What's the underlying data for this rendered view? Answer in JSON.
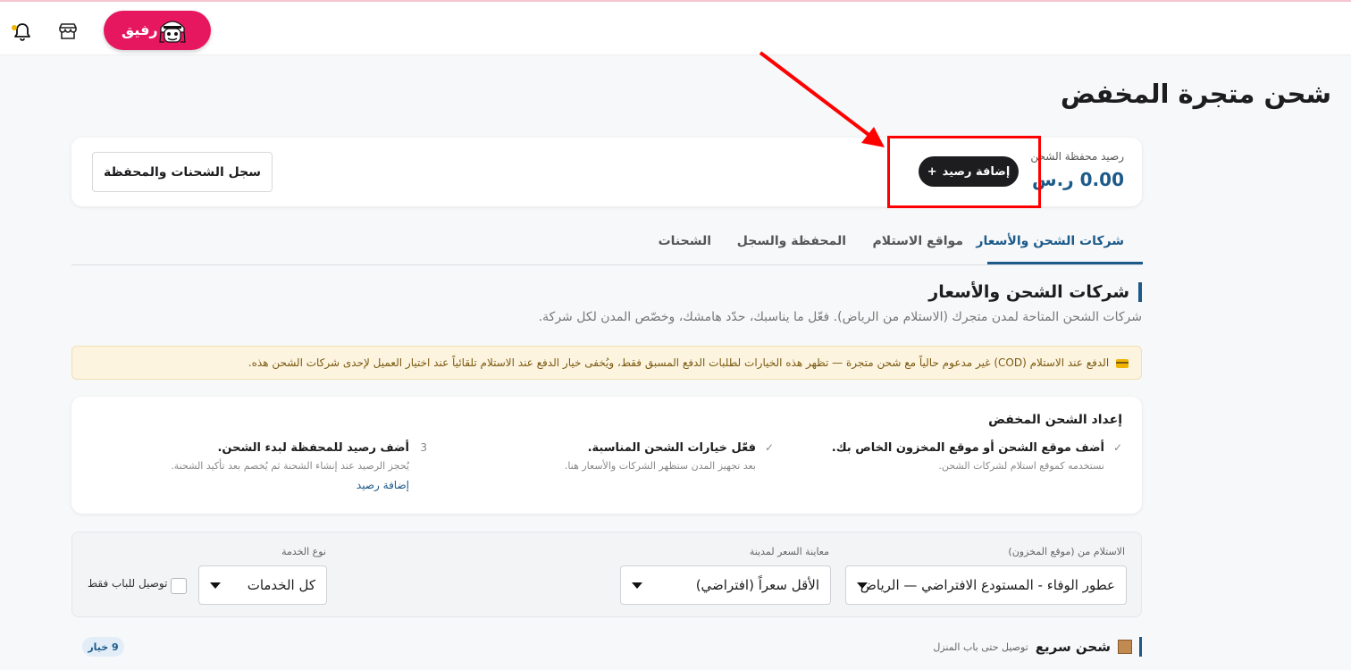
{
  "topbar": {
    "brand_label": "رفيق",
    "icons": [
      "bell-icon",
      "store-icon",
      "rafeeq-avatar-icon"
    ]
  },
  "page": {
    "title": "شحن متجرة المخفض"
  },
  "wallet": {
    "label": "رصيد محفظة الشحن",
    "amount": "0.00 ر.س",
    "add_button": "إضافة رصيد",
    "add_icon": "+",
    "history_button": "سجل الشحنات والمحفظة"
  },
  "tabs": [
    {
      "label": "شركات الشحن والأسعار",
      "active": true
    },
    {
      "label": "مواقع الاستلام",
      "active": false
    },
    {
      "label": "المحفظة والسجل",
      "active": false
    },
    {
      "label": "الشحنات",
      "active": false
    }
  ],
  "section": {
    "title": "شركات الشحن والأسعار",
    "subtitle": "شركات الشحن المتاحة لمدن متجرك (الاستلام من الرياض). فعّل ما يناسبك، حدّد هامشك، وخصّص المدن لكل شركة."
  },
  "cod_notice": "الدفع عند الاستلام (COD) غير مدعوم حالياً مع شحن متجرة — تظهر هذه الخيارات لطلبات الدفع المسبق فقط، ويُخفى خيار الدفع عند الاستلام تلقائياً عند اختيار العميل لإحدى شركات الشحن هذه.",
  "setup": {
    "title": "إعداد الشحن المخفض",
    "steps": [
      {
        "mark": "✓",
        "title": "أضف موقع الشحن أو موقع المخزون الخاص بك.",
        "desc": "نستخدمه كموقع استلام لشركات الشحن."
      },
      {
        "mark": "✓",
        "title": "فعّل خيارات الشحن المناسبة.",
        "desc": "بعد تجهيز المدن ستظهر الشركات والأسعار هنا."
      },
      {
        "mark": "3",
        "title": "أضف رصيد للمحفظة لبدء الشحن.",
        "desc": "يُحجز الرصيد عند إنشاء الشحنة ثم يُخصم بعد تأكيد الشحنة.",
        "link": "إضافة رصيد"
      }
    ]
  },
  "filters": {
    "pickup_label": "الاستلام من (موقع المخزون)",
    "pickup_value": "عطور الوفاء - المستودع الافتراضي — الرياض",
    "city_label": "معاينة السعر لمدينة",
    "city_value": "الأقل سعراً (افتراضي)",
    "service_label": "نوع الخدمة",
    "service_value": "كل الخدمات",
    "door_only_label": "توصيل للباب فقط",
    "door_only_checked": false
  },
  "group": {
    "title": "شحن سريع",
    "subtitle": "توصيل حتى باب المنزل",
    "count": "9 خيار",
    "icon": "box-icon"
  },
  "colors": {
    "brand": "#e6165f",
    "accent": "#1c5a8a",
    "highlight": "#ff0000"
  }
}
